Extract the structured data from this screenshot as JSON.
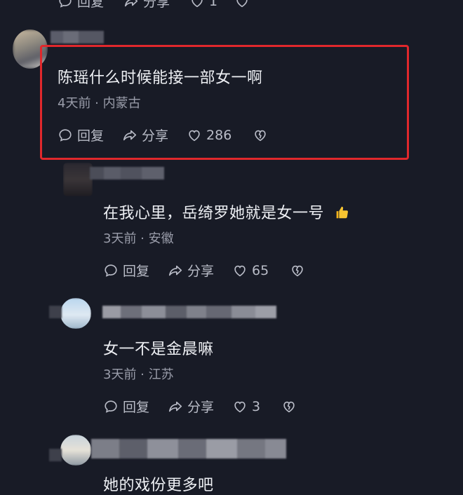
{
  "colors": {
    "background": "#181b26",
    "highlight_border": "#e0282c",
    "meta_text": "#9a9daa",
    "action_text": "#b9bcc7"
  },
  "top_partial": {
    "reply_label": "回复",
    "share_label": "分享",
    "like_count": "1"
  },
  "comments": [
    {
      "text": "陈瑶什么时候能接一部女一啊",
      "meta": "4天前 · 内蒙古",
      "reply_label": "回复",
      "share_label": "分享",
      "like_count": "286",
      "highlighted": true
    },
    {
      "text": "在我心里，岳绮罗她就是女一号",
      "emoji": "thumbs-up-emoji",
      "meta": "3天前 · 安徽",
      "reply_label": "回复",
      "share_label": "分享",
      "like_count": "65"
    },
    {
      "text": "女一不是金晨嘛",
      "meta": "3天前 · 江苏",
      "reply_label": "回复",
      "share_label": "分享",
      "like_count": "3"
    },
    {
      "text": "她的戏份更多吧"
    }
  ],
  "icons": {
    "reply": "comment-bubble-icon",
    "share": "share-arrow-icon",
    "like": "heart-icon",
    "dislike": "broken-heart-icon"
  }
}
